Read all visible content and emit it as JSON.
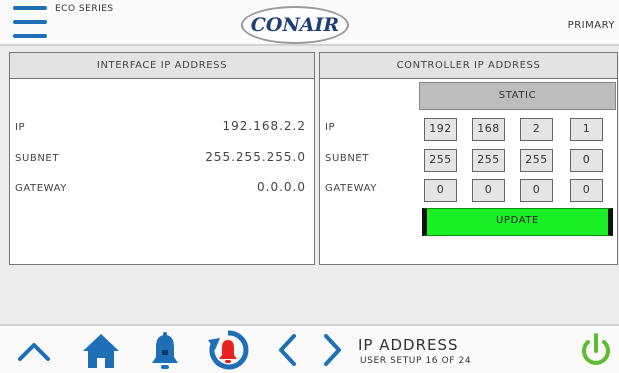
{
  "header": {
    "series": "ECO SERIES",
    "logo_text": "CONAIR",
    "mode": "PRIMARY"
  },
  "interface_panel": {
    "title": "INTERFACE IP ADDRESS",
    "rows": [
      {
        "label": "IP",
        "value": "192.168.2.2"
      },
      {
        "label": "SUBNET",
        "value": "255.255.255.0"
      },
      {
        "label": "GATEWAY",
        "value": "0.0.0.0"
      }
    ]
  },
  "controller_panel": {
    "title": "CONTROLLER IP ADDRESS",
    "mode_button": "STATIC",
    "rows": [
      {
        "label": "IP",
        "octets": [
          "192",
          "168",
          "2",
          "1"
        ]
      },
      {
        "label": "SUBNET",
        "octets": [
          "255",
          "255",
          "255",
          "0"
        ]
      },
      {
        "label": "GATEWAY",
        "octets": [
          "0",
          "0",
          "0",
          "0"
        ]
      }
    ],
    "update_button": "UPDATE"
  },
  "footer": {
    "screen_title": "IP ADDRESS",
    "screen_sub": "USER SETUP 16 OF 24",
    "icons": [
      "chevron-up-icon",
      "home-icon",
      "bell-icon",
      "alarm-reset-icon",
      "chevron-left-icon",
      "chevron-right-icon",
      "power-icon"
    ]
  },
  "colors": {
    "accent": "#1e6fb6",
    "update_green": "#1bf027",
    "alarm_red": "#e8231f",
    "power_green": "#5bbd2f"
  }
}
